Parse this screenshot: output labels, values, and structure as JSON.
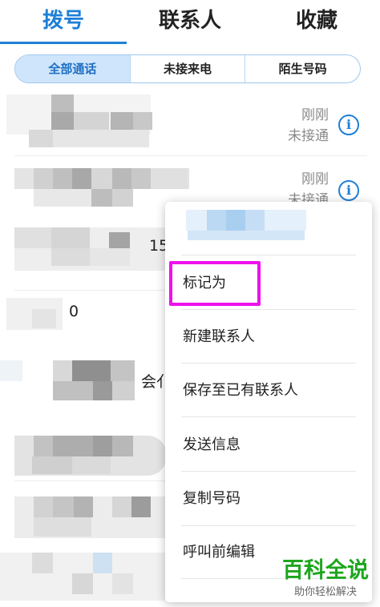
{
  "top_tabs": [
    {
      "label": "拨号",
      "active": true
    },
    {
      "label": "联系人",
      "active": false
    },
    {
      "label": "收藏",
      "active": false
    }
  ],
  "filter_tabs": [
    {
      "label": "全部通话",
      "selected": true
    },
    {
      "label": "未接来电",
      "selected": false
    },
    {
      "label": "陌生号码",
      "selected": false
    }
  ],
  "call_log": [
    {
      "time": "刚刚",
      "status": "未接通"
    },
    {
      "time": "刚刚",
      "status": "未接通"
    }
  ],
  "partial_text": {
    "number_fragment": "15",
    "label_fragment": "会亻",
    "digit_fragment": "0"
  },
  "menu": {
    "items": [
      {
        "label": "标记为"
      },
      {
        "label": "新建联系人"
      },
      {
        "label": "保存至已有联系人"
      },
      {
        "label": "发送信息"
      },
      {
        "label": "复制号码"
      },
      {
        "label": "呼叫前编辑"
      }
    ]
  },
  "watermark": {
    "title": "百科全说",
    "subtitle": "助你轻松解决"
  },
  "colors": {
    "accent": "#1e7fd8",
    "highlight": "#ee10ee",
    "watermark": "#1da61d"
  },
  "icons": [
    "info-icon"
  ]
}
